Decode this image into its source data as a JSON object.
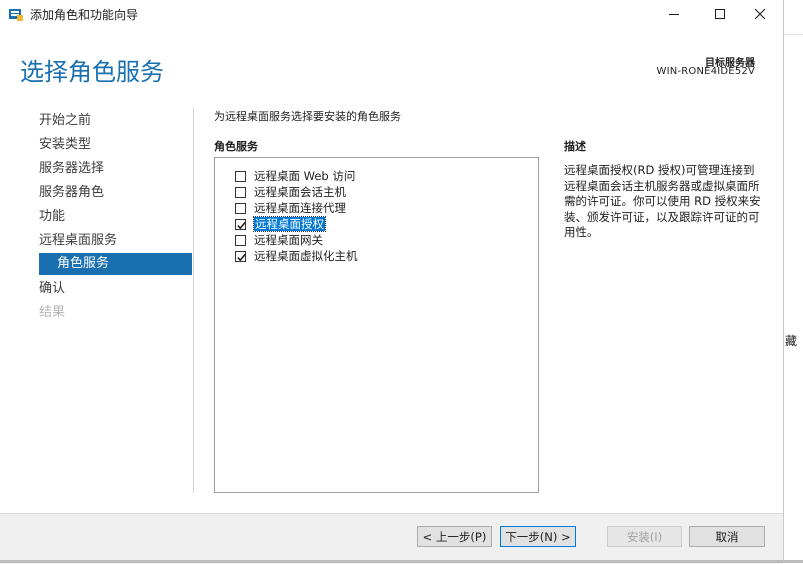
{
  "window": {
    "title": "添加角色和功能向导",
    "controls": {
      "minimize": "minimize",
      "maximize": "maximize",
      "close": "close"
    }
  },
  "header": {
    "page_title": "选择角色服务",
    "target_server_label": "目标服务器",
    "target_server_name": "WIN-RONE4IDE52V"
  },
  "nav": {
    "items": [
      {
        "label": "开始之前",
        "state": "normal"
      },
      {
        "label": "安装类型",
        "state": "normal"
      },
      {
        "label": "服务器选择",
        "state": "normal"
      },
      {
        "label": "服务器角色",
        "state": "normal"
      },
      {
        "label": "功能",
        "state": "normal"
      },
      {
        "label": "远程桌面服务",
        "state": "normal"
      },
      {
        "label": "角色服务",
        "state": "active"
      },
      {
        "label": "确认",
        "state": "normal"
      },
      {
        "label": "结果",
        "state": "disabled"
      }
    ]
  },
  "content": {
    "instruction": "为远程桌面服务选择要安装的角色服务",
    "role_services_heading": "角色服务",
    "role_services": [
      {
        "label": "远程桌面 Web 访问",
        "checked": false,
        "selected": false
      },
      {
        "label": "远程桌面会话主机",
        "checked": false,
        "selected": false
      },
      {
        "label": "远程桌面连接代理",
        "checked": false,
        "selected": false
      },
      {
        "label": "远程桌面授权",
        "checked": true,
        "selected": true
      },
      {
        "label": "远程桌面网关",
        "checked": false,
        "selected": false
      },
      {
        "label": "远程桌面虚拟化主机",
        "checked": true,
        "selected": false
      }
    ],
    "description_heading": "描述",
    "description": "远程桌面授权(RD 授权)可管理连接到远程桌面会话主机服务器或虚拟桌面所需的许可证。你可以使用 RD 授权来安装、颁发许可证，以及跟踪许可证的可用性。"
  },
  "footer": {
    "previous": "< 上一步(P)",
    "next": "下一步(N) >",
    "install": "安装(I)",
    "cancel": "取消"
  },
  "background_window": {
    "partial_text": "藏"
  },
  "colors": {
    "accent": "#1a6fb0",
    "selection": "#0078d7"
  }
}
